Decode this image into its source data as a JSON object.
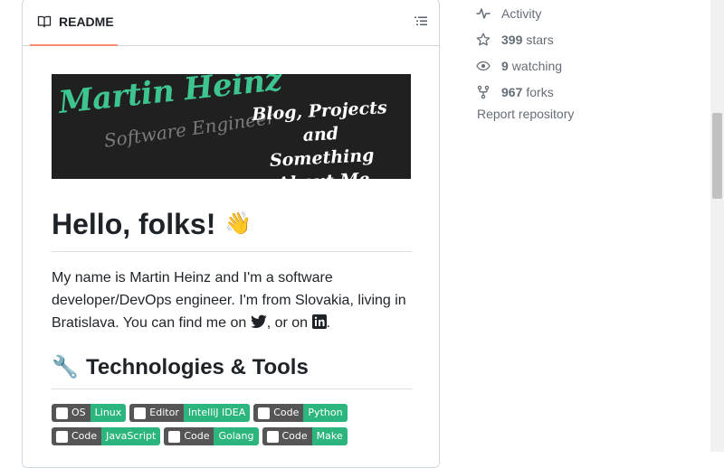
{
  "readme": {
    "tab_label": "README",
    "banner": {
      "name": "Martin Heinz",
      "role": "Software Engineer",
      "tagline_line1": "Blog, Projects and",
      "tagline_line2": "Something About Me"
    },
    "heading": "Hello, folks!",
    "heading_emoji": "👋",
    "intro_text": "My name is Martin Heinz and I'm a software developer/DevOps engineer. I'm from Slovakia, living in Bratislava. You can find me on ",
    "intro_or": ", or on ",
    "intro_end": ".",
    "section_title": "Technologies & Tools",
    "section_emoji": "🔧",
    "badges": [
      {
        "left": "OS",
        "right": "Linux"
      },
      {
        "left": "Editor",
        "right": "IntelliJ IDEA"
      },
      {
        "left": "Code",
        "right": "Python"
      },
      {
        "left": "Code",
        "right": "JavaScript"
      },
      {
        "left": "Code",
        "right": "Golang"
      },
      {
        "left": "Code",
        "right": "Make"
      }
    ]
  },
  "sidebar": {
    "activity": "Activity",
    "stars_count": "399",
    "stars_label": "stars",
    "watching_count": "9",
    "watching_label": "watching",
    "forks_count": "967",
    "forks_label": "forks",
    "report": "Report repository"
  },
  "colors": {
    "accent_underline": "#fd8c73",
    "badge_green": "#2cb67d",
    "banner_green": "#3ec48f"
  },
  "icons": [
    "book-icon",
    "list-outline-icon",
    "pulse-icon",
    "star-icon",
    "eye-icon",
    "fork-icon",
    "twitter-icon",
    "linkedin-icon",
    "wrench-icon",
    "wave-icon"
  ]
}
